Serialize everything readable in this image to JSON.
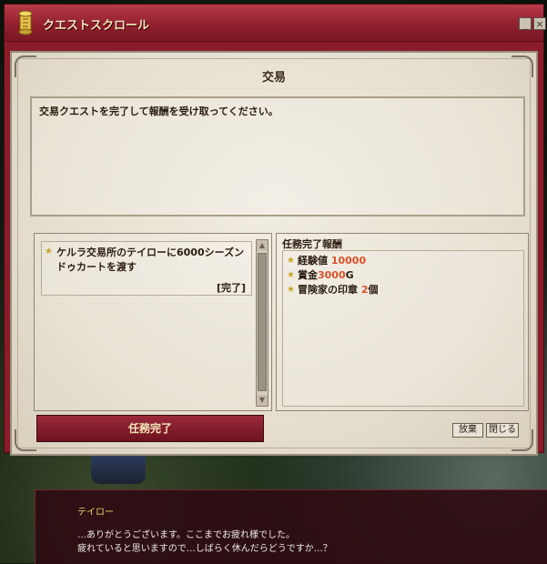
{
  "window": {
    "title": "クエストスクロール",
    "minimize_label": "_",
    "close_label": "×"
  },
  "quest": {
    "name": "交易",
    "description": "交易クエストを完了して報酬を受け取ってください。",
    "objective": {
      "text": "ケルラ交易所のテイローに6000シーズンドゥカートを渡す",
      "status": "[完了]"
    },
    "rewards": {
      "header": "任務完了報酬",
      "items": [
        {
          "label": "経験値",
          "value": "10000",
          "suffix": ""
        },
        {
          "label": "賞金",
          "value": "3000",
          "suffix": "G"
        },
        {
          "label": "冒険家の印章",
          "value": "2",
          "suffix": "個"
        }
      ]
    },
    "complete_button": "任務完了",
    "abandon_button": "放棄",
    "close_button": "閉じる"
  },
  "dialog": {
    "npc_name": "テイロー",
    "line1": "…ありがとうございます。ここまでお疲れ様でした。",
    "line2": "疲れていると思いますので…しばらく休んだらどうですか…？"
  },
  "colors": {
    "window_frame": "#8a1c2a",
    "highlight": "#d8522a",
    "button": "#6e1220"
  }
}
